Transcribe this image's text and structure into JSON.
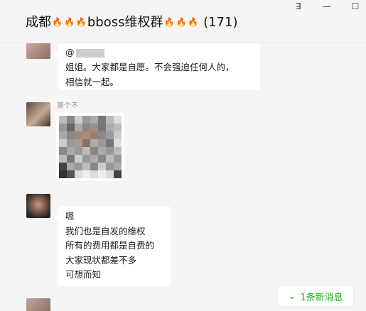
{
  "header": {
    "title_prefix": "成都",
    "title_middle": "bboss维权群",
    "member_count": "(171)",
    "fire_icon": "🔥",
    "pin_icon": "ꓱ",
    "minimize_icon": "—",
    "maximize_icon": "☐"
  },
  "messages": [
    {
      "mention": "@",
      "lines": [
        "姐姐。大家都是自愿。不会强迫任何人的，",
        "相信就一起。"
      ]
    },
    {
      "sender": "萧个不"
    },
    {
      "lines": [
        " 嗯",
        "我们也是自发的维权",
        "所有的费用都是自费的",
        "大家现状都差不多",
        "可想而知"
      ]
    }
  ],
  "new_message_bar": {
    "label": "1条新消息",
    "chevron": "⌄"
  },
  "colors": {
    "accent_green": "#1aad19",
    "chat_background": "#f5f5f5",
    "bubble_background": "#ffffff"
  }
}
